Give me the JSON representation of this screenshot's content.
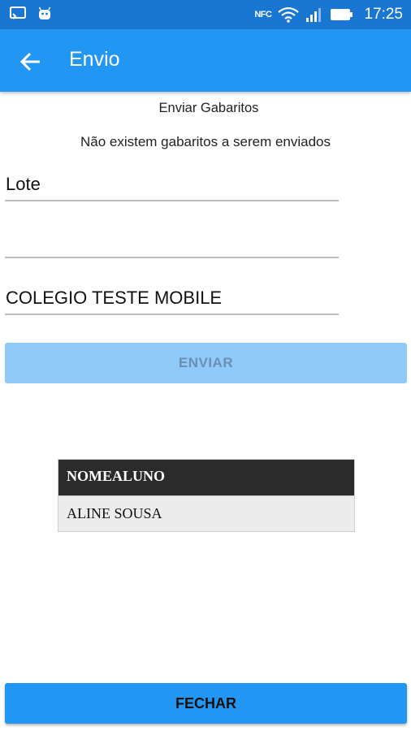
{
  "status_bar": {
    "time": "17:25",
    "nfc_label": "NFC",
    "icons": [
      "cast-icon",
      "android-icon",
      "nfc-icon",
      "wifi-icon",
      "signal-icon",
      "battery-icon"
    ]
  },
  "app_bar": {
    "title": "Envio",
    "back_icon": "arrow-back-icon"
  },
  "content": {
    "subtitle": "Enviar Gabaritos",
    "message": "Não existem gabaritos a serem enviados",
    "fields": {
      "lote": "Lote",
      "blank": "",
      "escola": "COLEGIO TESTE MOBILE"
    },
    "send_button": "ENVIAR"
  },
  "table": {
    "header": "NOMEALUNO",
    "rows": [
      "ALINE SOUSA"
    ]
  },
  "footer": {
    "close_button": "FECHAR"
  },
  "colors": {
    "status_bar": "#1976d2",
    "app_bar": "#2196f3",
    "disabled_button": "#90caf9",
    "primary_button": "#2196f3",
    "table_header": "#2b2b2b"
  }
}
